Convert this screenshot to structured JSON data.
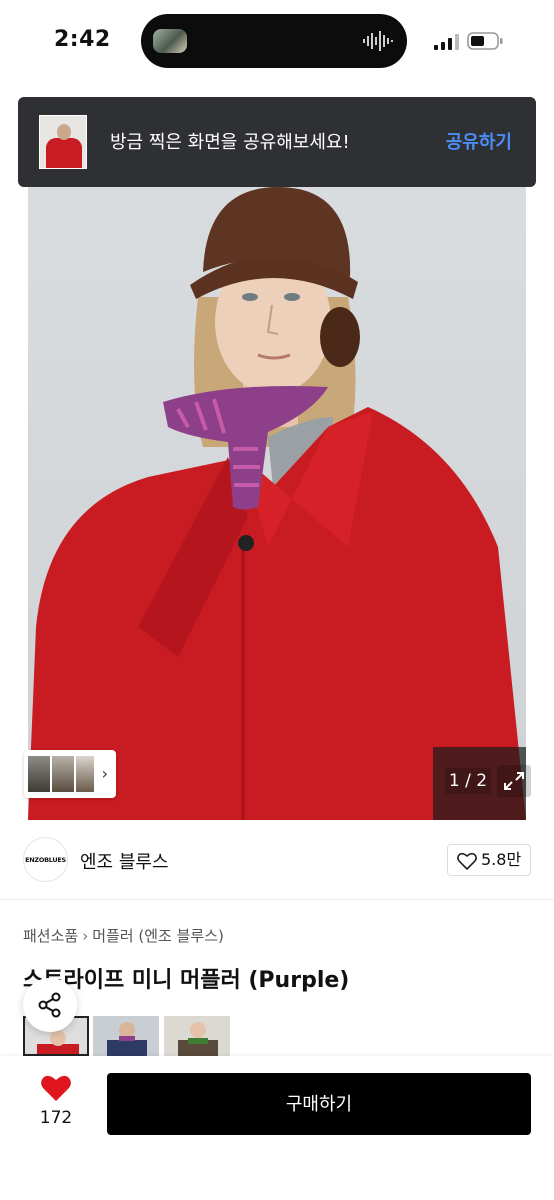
{
  "status_bar": {
    "time": "2:42"
  },
  "toast": {
    "message": "방금 찍은 화면을 공유해보세요!",
    "action_label": "공유하기"
  },
  "gallery": {
    "page_indicator": "1 / 2"
  },
  "brand": {
    "logo_text": "ENZOBLUES",
    "name": "엔조 블루스",
    "like_count": "5.8만"
  },
  "breadcrumb": {
    "category": "패션소품",
    "subcategory": "머플러 (엔조 블루스)"
  },
  "product": {
    "title": "스트라이프 미니 머플러 (Purple)"
  },
  "bottom_bar": {
    "wish_count": "172",
    "buy_label": "구매하기"
  },
  "colors": {
    "accent_blue": "#4a8ef5",
    "wish_red": "#e1151e",
    "coat_red": "#c91b22"
  }
}
